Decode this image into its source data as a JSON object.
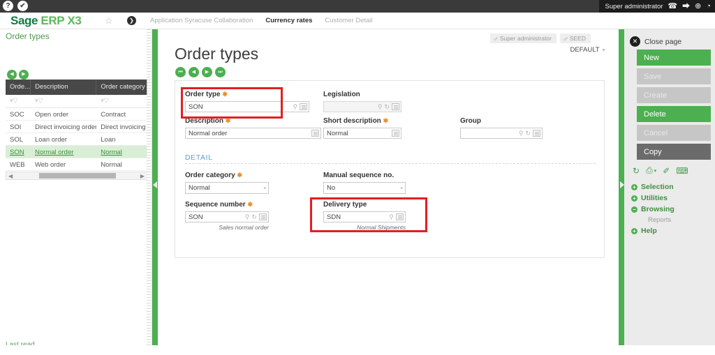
{
  "topbar": {
    "left_icons": [
      {
        "name": "help-icon",
        "glyph": "?"
      },
      {
        "name": "broom-icon",
        "glyph": "✔"
      }
    ],
    "user_label": "Super administrator",
    "right_icons": [
      {
        "name": "headset-icon",
        "glyph": "☎"
      },
      {
        "name": "logout-icon",
        "glyph": "⮕"
      },
      {
        "name": "globe-icon",
        "glyph": "⊕"
      },
      {
        "name": "settings-icon",
        "glyph": "◔"
      }
    ]
  },
  "header": {
    "brand_sage": "Sage",
    "brand_erp": "ERP",
    "brand_x3": "X3",
    "favorite_icon": "☆",
    "chevron_icon": "❯",
    "tabs": [
      {
        "label": "Application Syracuse Collaboration",
        "active": false
      },
      {
        "label": "Currency rates",
        "active": true
      },
      {
        "label": "Customer Detail",
        "active": false
      }
    ]
  },
  "left_panel": {
    "title": "Order types",
    "nav_buttons": [
      {
        "name": "prev-page-button",
        "glyph": "◀"
      },
      {
        "name": "next-page-button",
        "glyph": "▶"
      }
    ],
    "columns": [
      "Orde...",
      "Description",
      "Order category"
    ],
    "filter_icon": "ὓD",
    "rows": [
      {
        "code": "SOC",
        "description": "Open order",
        "category": "Contract",
        "selected": false
      },
      {
        "code": "SOI",
        "description": "Direct invoicing order",
        "category": "Direct invoicing",
        "selected": false
      },
      {
        "code": "SOL",
        "description": "Loan order",
        "category": "Loan",
        "selected": false
      },
      {
        "code": "SON",
        "description": "Normal order",
        "category": "Normal",
        "selected": true
      },
      {
        "code": "WEB",
        "description": "Web order",
        "category": "Normal",
        "selected": false
      }
    ],
    "scroll_left_arrow": "◀",
    "scroll_right_arrow": "▶",
    "status": "Last read"
  },
  "main": {
    "title": "Order types",
    "pager": [
      {
        "name": "first-record-button",
        "glyph": "⏮"
      },
      {
        "name": "previous-record-button",
        "glyph": "◀"
      },
      {
        "name": "next-record-button",
        "glyph": "▶"
      },
      {
        "name": "last-record-button",
        "glyph": "⏭"
      }
    ],
    "badges": [
      {
        "label": "Super administrator",
        "icon": "⚷"
      },
      {
        "label": "SEED",
        "icon": "⚷"
      }
    ],
    "default_selector": "DEFAULT",
    "default_caret": "▼",
    "fields": {
      "order_type": {
        "label": "Order type",
        "required": true,
        "value": "SON",
        "highlighted": true
      },
      "legislation": {
        "label": "Legislation",
        "required": false,
        "value": "",
        "disabled": true
      },
      "description": {
        "label": "Description",
        "required": true,
        "value": "Normal order"
      },
      "short_description": {
        "label": "Short description",
        "required": true,
        "value": "Normal"
      },
      "group": {
        "label": "Group",
        "required": false,
        "value": ""
      },
      "order_category": {
        "label": "Order category",
        "required": true,
        "value": "Normal"
      },
      "manual_sequence_no": {
        "label": "Manual sequence no.",
        "required": false,
        "value": "No"
      },
      "sequence_number": {
        "label": "Sequence number",
        "required": true,
        "value": "SON",
        "helper": "Sales normal order"
      },
      "delivery_type": {
        "label": "Delivery type",
        "required": false,
        "value": "SDN",
        "helper": "Normal  Shipments",
        "highlighted": true
      }
    },
    "section_detail": "DETAIL",
    "icons": {
      "search": "⚲",
      "refresh": "↻",
      "lookup": "▤",
      "caret": "▾",
      "required_star": "✱"
    }
  },
  "right_panel": {
    "close_page": "Close page",
    "close_icon": "✕",
    "buttons": [
      {
        "label": "New",
        "state": "green"
      },
      {
        "label": "Save",
        "state": "grey"
      },
      {
        "label": "Create",
        "state": "grey"
      },
      {
        "label": "Delete",
        "state": "green"
      },
      {
        "label": "Cancel",
        "state": "grey"
      },
      {
        "label": "Copy",
        "state": "dark"
      }
    ],
    "tool_icons": [
      {
        "name": "refresh-icon",
        "glyph": "↻"
      },
      {
        "name": "print-icon",
        "glyph": "⎙"
      },
      {
        "name": "print-caret-icon",
        "glyph": "▾"
      },
      {
        "name": "attachment-icon",
        "glyph": "✐"
      },
      {
        "name": "comment-icon",
        "glyph": "⌨"
      }
    ],
    "menu": [
      {
        "label": "Selection",
        "expanded": false,
        "sign": "+"
      },
      {
        "label": "Utilities",
        "expanded": false,
        "sign": "+"
      },
      {
        "label": "Browsing",
        "expanded": true,
        "sign": "−"
      }
    ],
    "browsing_sub": "Reports",
    "help": {
      "label": "Help",
      "sign": "+"
    }
  },
  "colors": {
    "brand_green": "#0c7e3f",
    "accent_green": "#4caf50",
    "highlight_red": "#e02020",
    "required_orange": "#f08a24",
    "section_blue": "#5a9fd4"
  }
}
